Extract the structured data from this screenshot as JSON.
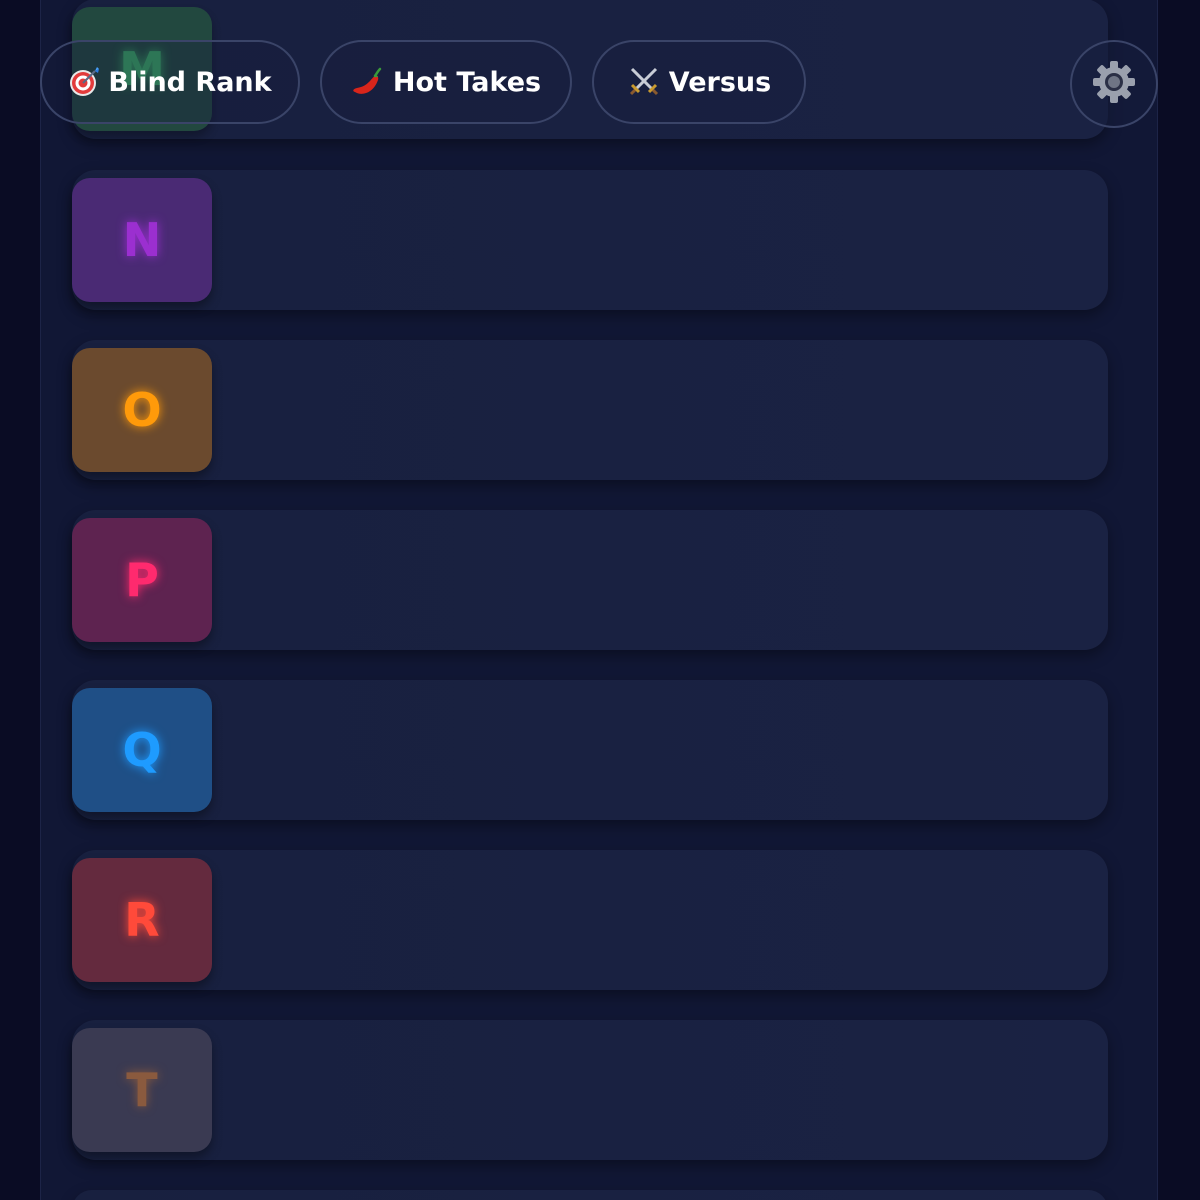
{
  "modes": [
    {
      "id": "blind-rank",
      "label": "Blind Rank",
      "icon": "target-icon"
    },
    {
      "id": "hot-takes",
      "label": "Hot Takes",
      "icon": "chili-pepper-icon"
    },
    {
      "id": "versus",
      "label": "Versus",
      "icon": "crossed-swords-icon"
    }
  ],
  "settings": {
    "icon": "gear-icon"
  },
  "tiers": [
    {
      "letter": "M",
      "color": "#3fbf6b",
      "badge_bg": "#24503f"
    },
    {
      "letter": "N",
      "color": "#9b2fd0",
      "badge_bg": "#4a2a74"
    },
    {
      "letter": "O",
      "color": "#ff9a0a",
      "badge_bg": "#6b4a2e"
    },
    {
      "letter": "P",
      "color": "#ff2a6e",
      "badge_bg": "#5e2350"
    },
    {
      "letter": "Q",
      "color": "#1e9bff",
      "badge_bg": "#1f4f86"
    },
    {
      "letter": "R",
      "color": "#ff4a3a",
      "badge_bg": "#642a3e"
    },
    {
      "letter": "T",
      "color": "#8a5a3e",
      "badge_bg": "#3a3a52"
    }
  ],
  "colors": {
    "background": "#0a0c24",
    "panel": "#111735",
    "row": "#18203f",
    "button_border": "#3a4468"
  }
}
